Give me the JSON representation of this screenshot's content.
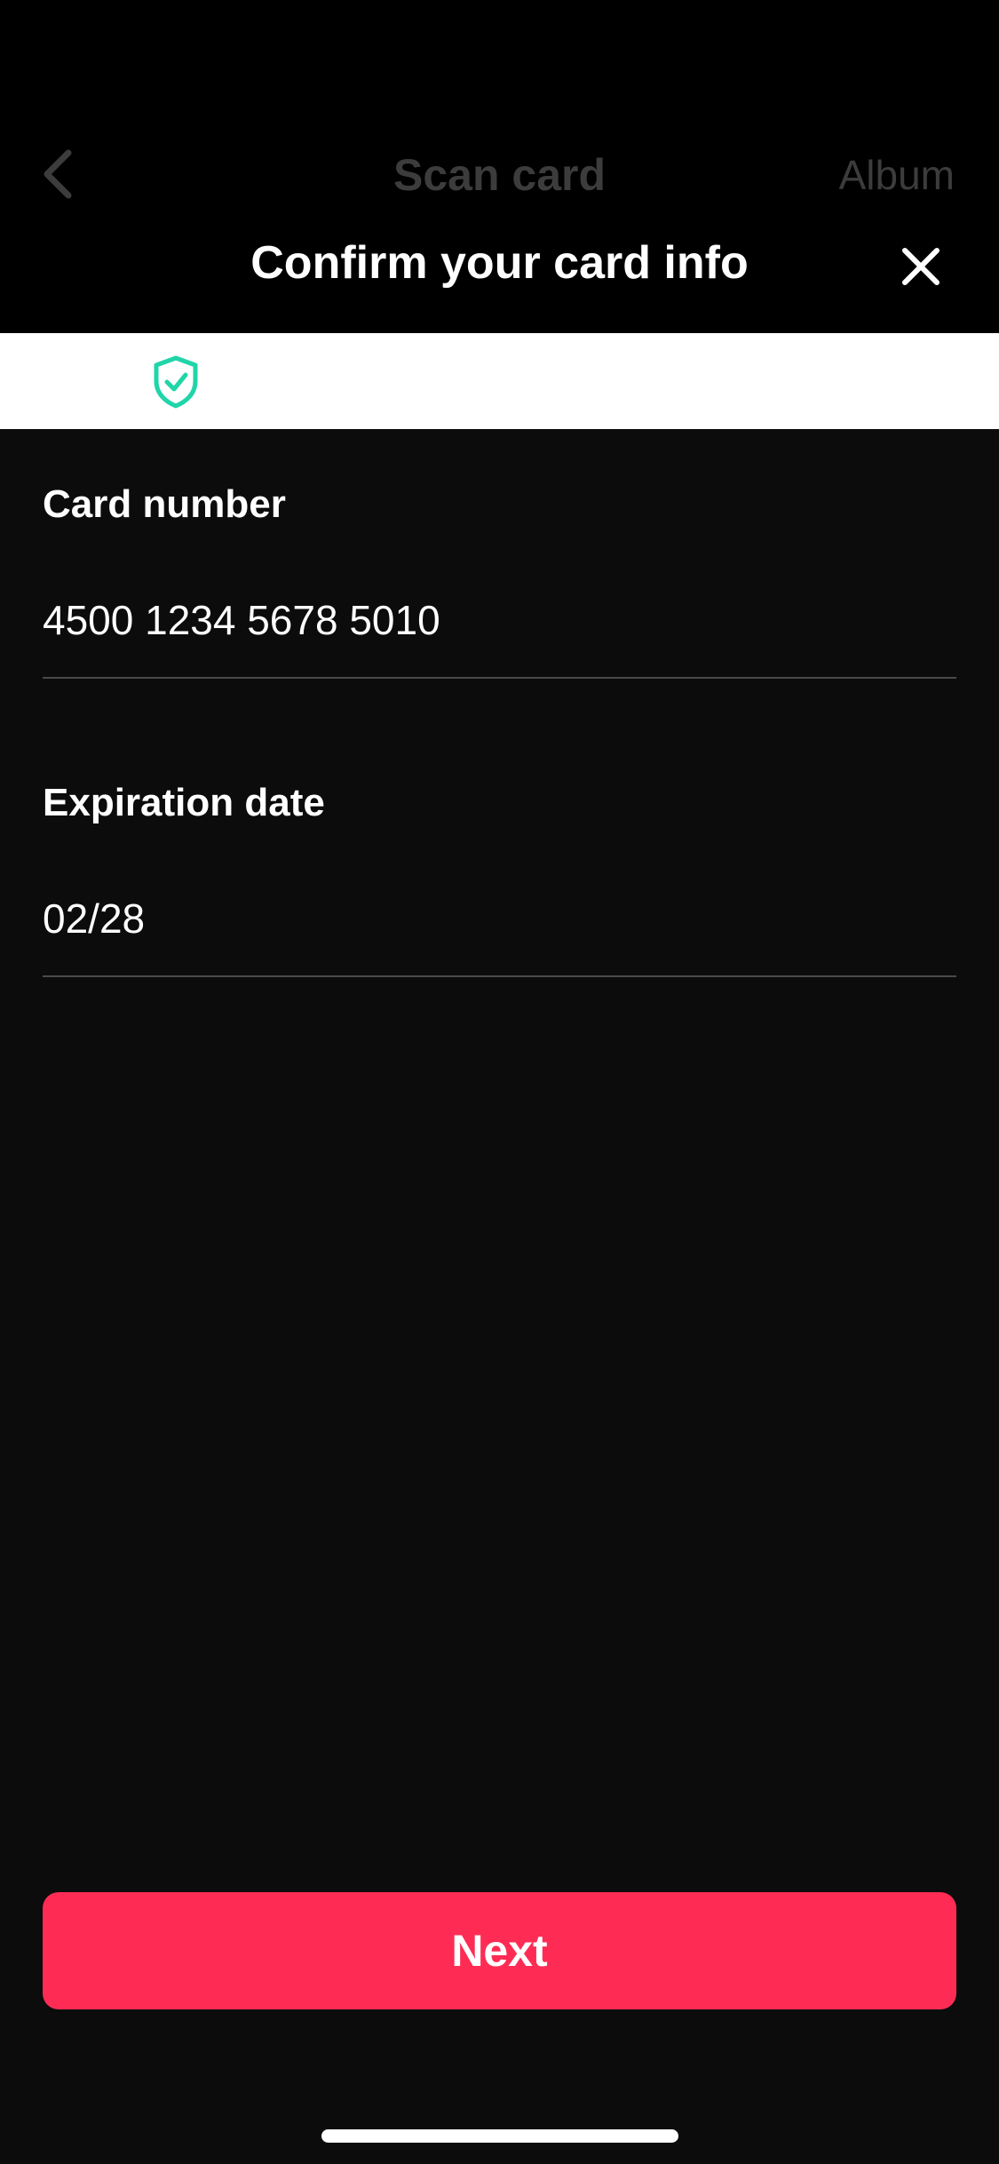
{
  "background_screen": {
    "title": "Scan card",
    "album_label": "Album",
    "back_icon": "chevron-left-icon"
  },
  "sheet": {
    "title": "Confirm your card info",
    "close_icon": "close-icon",
    "secure_icon": "shield-check-icon"
  },
  "fields": {
    "card_number": {
      "label": "Card number",
      "value": "4500 1234 5678 5010"
    },
    "expiration_date": {
      "label": "Expiration date",
      "value": "02/28"
    }
  },
  "actions": {
    "next_label": "Next"
  },
  "colors": {
    "accent": "#fe2c55",
    "secure_green": "#20d5a8",
    "background": "#0c0c0c",
    "dimmed_text": "#3c3c3c"
  }
}
